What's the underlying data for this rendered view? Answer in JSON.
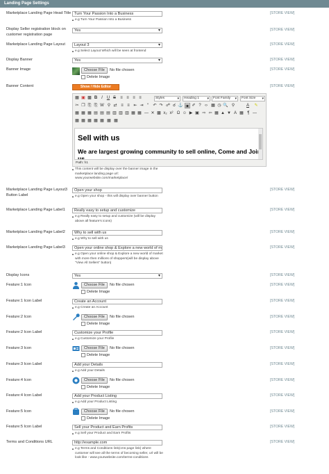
{
  "header": {
    "title": "Landing Page Settings"
  },
  "store_view": "[STORE VIEW]",
  "file_button": "Choose File",
  "no_file": "No file chosen",
  "delete_image": "Delete Image",
  "rows": {
    "head_title": {
      "label": "Marketplace Landing Page Head Title",
      "value": "Turn Your Passion Into a Business",
      "note": "e.g Turn Your Passion Into a Business"
    },
    "seller_reg": {
      "label": "Display Seller registration block on customer registration page",
      "value": "Yes"
    },
    "layout": {
      "label": "Marketplace Landing Page Layout",
      "value": "Layout 3",
      "note": "e.g Select Layout Which will be seen at frontend"
    },
    "display_banner": {
      "label": "Display Banner",
      "value": "Yes"
    },
    "banner_image": {
      "label": "Banner Image"
    },
    "banner_content": {
      "label": "Banner Content",
      "toggle": "Show / Hide Editor",
      "note": "This content will be display over the banner image in the marketplace landing page url: www.yourwebsite.com/marketplace/"
    },
    "layout3_button": {
      "label": "Marketplace Landing Page Layout3 Button Label",
      "value": "Open your shop",
      "note": "e.g Open your shop - this will display over banner button"
    },
    "label1": {
      "label": "Marketplace Landing Page Label1",
      "value": "Really easy to setup and customize",
      "note": "e.g Really easy to setup and customize (will be display above all feature's icons)"
    },
    "label2": {
      "label": "Marketplace Landing Page Label2",
      "value": "Why to sell with us",
      "note": "e.g Why to sell with us"
    },
    "label3": {
      "label": "Marketplace Landing Page Label3",
      "value": "Open your online shop & Explore a new world of m",
      "note": "e.g Open your online shop & Explore a new world of market with more then millions of shoppers(will be display above \"View All Sellers\" button)"
    },
    "display_icons": {
      "label": "Display Icons",
      "value": "Yes"
    },
    "f1_icon": {
      "label": "Feature:1 Icon"
    },
    "f1_label": {
      "label": "Feature:1 Icon Label",
      "value": "Create an Account",
      "note": "e.g Create an Account"
    },
    "f2_icon": {
      "label": "Feature:2 Icon"
    },
    "f2_label": {
      "label": "Feature:2 Icon Label",
      "value": "Customize your Profile",
      "note": "e.g Customize your Profile"
    },
    "f3_icon": {
      "label": "Feature:3 Icon"
    },
    "f3_label": {
      "label": "Feature:3 Icon Label",
      "value": "Add your Details",
      "note": "e.g Add your Details"
    },
    "f4_icon": {
      "label": "Feature:4 Icon"
    },
    "f4_label": {
      "label": "Feature:4 Icon Label",
      "value": "Add your Product Listing",
      "note": "e.g Add your Product Listing"
    },
    "f5_icon": {
      "label": "Feature:5 Icon"
    },
    "f5_label": {
      "label": "Feature:5 Icon Label",
      "value": "Sell your Product and Earn Profits",
      "note": "e.g Sell your Product and Earn Profits"
    },
    "terms": {
      "label": "Terms and Conditions URL",
      "value": "http://example.com",
      "note": "e.g Terms and Conditions link(cms page link) where customer will see all the terms of becoming seller, url will be look like - www.yourwebsite.com/terms-conditions"
    }
  },
  "editor": {
    "styles": "Styles",
    "format": "Heading 1",
    "font_family": "Font Family",
    "font_size": "Font Size",
    "heading": "Sell with us",
    "subheading": "We are largest growing community to sell online, Come and Join us.",
    "path": "Path: h1"
  }
}
